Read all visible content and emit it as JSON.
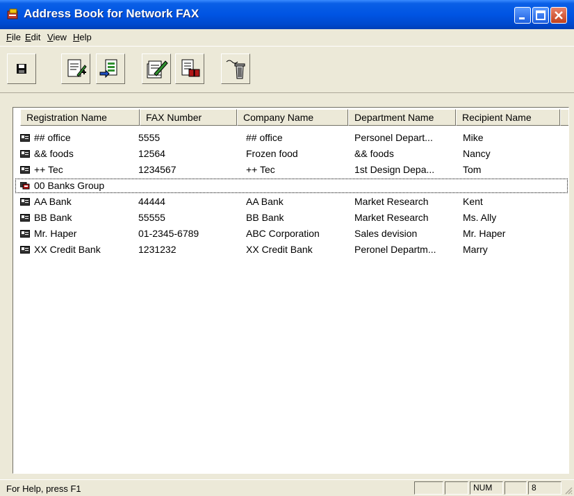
{
  "window": {
    "title": "Address Book for Network FAX"
  },
  "menu": [
    {
      "key": "F",
      "rest": "ile"
    },
    {
      "key": "E",
      "rest": "dit"
    },
    {
      "key": "V",
      "rest": "iew"
    },
    {
      "key": "H",
      "rest": "elp"
    }
  ],
  "toolbar": {
    "buttons": [
      "save-icon",
      "new-entry-icon",
      "import-icon",
      "edit-entry-icon",
      "find-icon",
      "delete-icon"
    ]
  },
  "list": {
    "columns": [
      "Registration Name",
      "FAX Number",
      "Company Name",
      "Department Name",
      "Recipient Name"
    ],
    "rows": [
      {
        "type": "person",
        "name": "## office",
        "fax": "5555",
        "company": "## office",
        "dept": "Personel Depart...",
        "recipient": "Mike"
      },
      {
        "type": "person",
        "name": "&& foods",
        "fax": "12564",
        "company": "Frozen food",
        "dept": "&& foods",
        "recipient": "Nancy"
      },
      {
        "type": "person",
        "name": "++ Tec",
        "fax": "1234567",
        "company": "++ Tec",
        "dept": "1st Design Depa...",
        "recipient": "Tom"
      },
      {
        "type": "group",
        "name": "00 Banks Group",
        "fax": "",
        "company": "",
        "dept": "",
        "recipient": ""
      },
      {
        "type": "person",
        "name": "AA Bank",
        "fax": "44444",
        "company": "AA Bank",
        "dept": "Market Research",
        "recipient": "Kent"
      },
      {
        "type": "person",
        "name": "BB Bank",
        "fax": "55555",
        "company": "BB Bank",
        "dept": "Market Research",
        "recipient": "Ms. Ally"
      },
      {
        "type": "person",
        "name": "Mr. Haper",
        "fax": "01-2345-6789",
        "company": "ABC Corporation",
        "dept": "Sales devision",
        "recipient": "Mr. Haper"
      },
      {
        "type": "person",
        "name": "XX Credit Bank",
        "fax": "1231232",
        "company": "XX Credit Bank",
        "dept": "Peronel Departm...",
        "recipient": "Marry"
      }
    ]
  },
  "status": {
    "help": "For Help, press F1",
    "num": "NUM",
    "count": "8"
  },
  "colors": {
    "titlebar": "#0054e3",
    "face": "#ece9d8",
    "close": "#c2401c"
  }
}
